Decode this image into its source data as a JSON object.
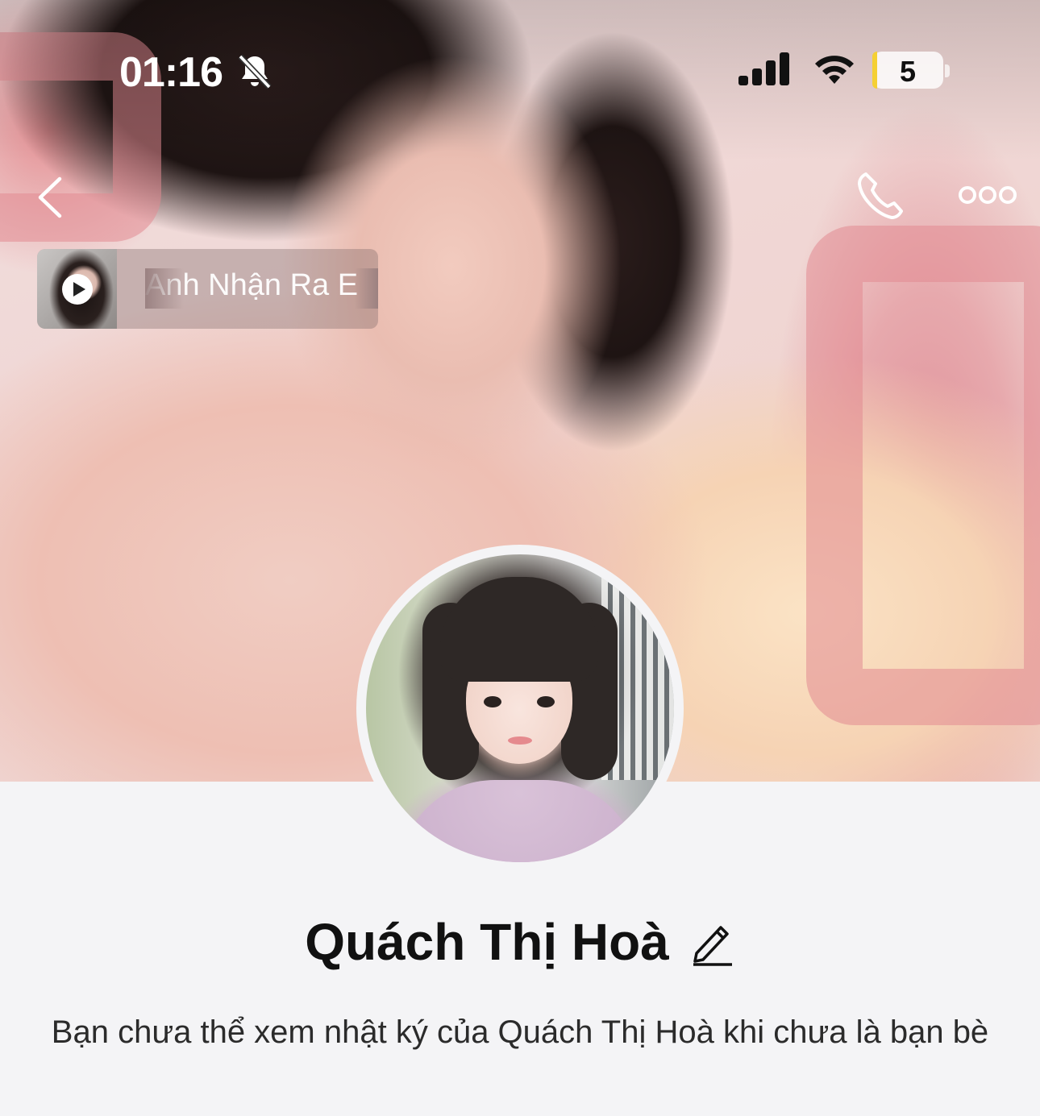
{
  "status_bar": {
    "time": "01:16",
    "battery_level": "5",
    "icons": [
      "bell-off-icon",
      "signal-icon",
      "wifi-icon",
      "battery-icon"
    ],
    "battery_color": "#f5d033"
  },
  "header": {
    "back_icon": "chevron-left-icon",
    "call_icon": "phone-icon",
    "more_icon": "more-dots-icon"
  },
  "music": {
    "title": "Anh Nhận Ra E",
    "icon": "play-icon"
  },
  "profile": {
    "name": "Quách Thị Hoà",
    "edit_icon": "pencil-icon",
    "notice": "Bạn chưa thể xem nhật ký của Quách Thị Hoà khi chưa là bạn bè"
  },
  "colors": {
    "background": "#f4f4f6",
    "text": "#111111"
  }
}
